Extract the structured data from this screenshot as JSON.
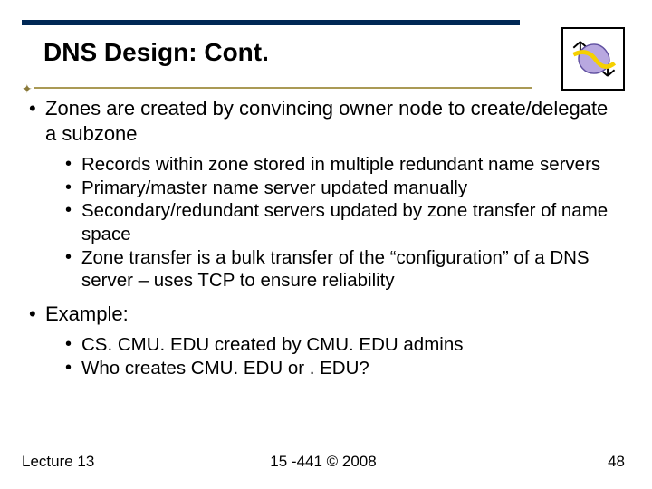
{
  "title": "DNS Design: Cont.",
  "bullets": {
    "b1": "Zones are created by convincing owner node to create/delegate a subzone",
    "b1_sub": [
      "Records within zone stored in multiple redundant name servers",
      "Primary/master name server updated manually",
      "Secondary/redundant servers updated by zone transfer of name space",
      "Zone transfer is a bulk transfer of the “configuration” of a DNS server – uses TCP to ensure reliability"
    ],
    "b2": "Example:",
    "b2_sub": [
      "CS. CMU. EDU created by CMU. EDU admins",
      "Who creates CMU. EDU or . EDU?"
    ]
  },
  "footer": {
    "left": "Lecture 13",
    "center": "15 -441 ©  2008",
    "right": "48"
  }
}
